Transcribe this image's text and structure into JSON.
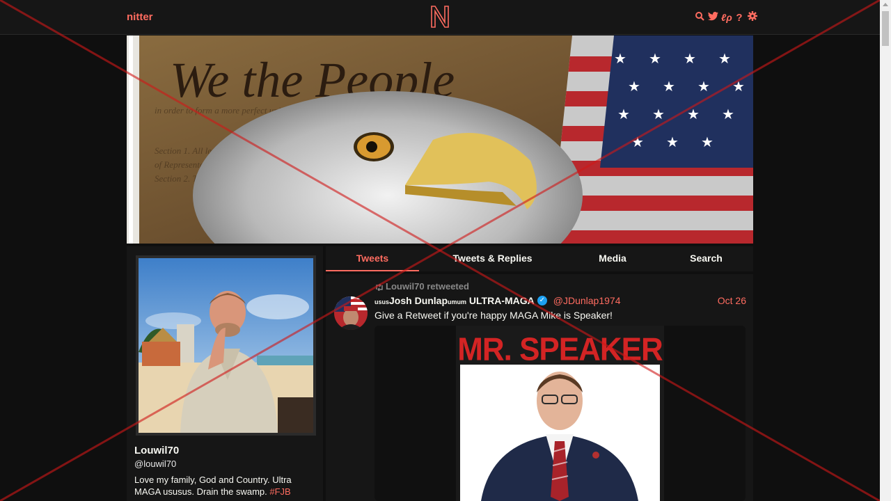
{
  "navbar": {
    "brand": "nitter",
    "icons": [
      "search-icon",
      "twitter-icon",
      "rss-icon",
      "help-icon",
      "gear-icon"
    ]
  },
  "colors": {
    "accent": "#ff6c60",
    "background": "#0f0f0f",
    "panel": "#161616",
    "verified": "#1da1f2"
  },
  "banner": {
    "heading": "We the People"
  },
  "profile": {
    "name": "Louwil70",
    "handle": "@louwil70",
    "bio": "Love my family, God and Country. Ultra MAGA ususus. Drain the swamp. ",
    "hashtag": "#FJB"
  },
  "tabs": [
    {
      "label": "Tweets",
      "active": true
    },
    {
      "label": "Tweets & Replies",
      "active": false
    },
    {
      "label": "Media",
      "active": false
    },
    {
      "label": "Search",
      "active": false
    }
  ],
  "tweet": {
    "retweet_label": "Louwil70 retweeted",
    "fullname_prefix": "usus",
    "fullname_main": "Josh Dunlap",
    "fullname_mid": "umum",
    "fullname_suffix": " ULTRA-MAGA",
    "verified_mark": "✓",
    "username": "@JDunlap1974",
    "date": "Oct 26",
    "text": "Give a Retweet if you're happy MAGA Mike is Speaker!",
    "image_heading": "MR. SPEAKER"
  }
}
